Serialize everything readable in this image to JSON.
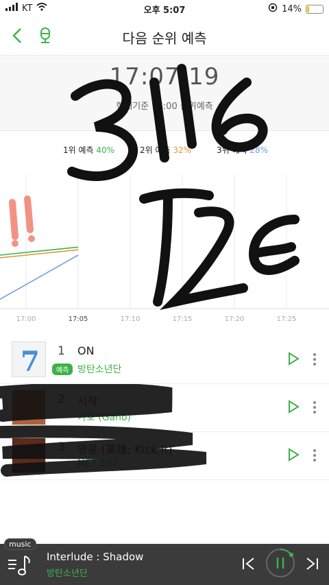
{
  "status": {
    "carrier": "KT",
    "time": "오후 5:07",
    "battery": "14%",
    "battery_level": 0.14
  },
  "header": {
    "title": "다음 순위 예측"
  },
  "timer": {
    "time": "17:07:19",
    "subtitle": "현재기준 18:00 순위예측"
  },
  "predictions": [
    {
      "label": "1위 예측",
      "value": "40%",
      "color": "#3cb34a"
    },
    {
      "label": "2위 예측",
      "value": "32%",
      "color": "#e0983a"
    },
    {
      "label": "3위 예측",
      "value": "28%",
      "color": "#6fa0e0"
    }
  ],
  "chart_data": {
    "type": "line",
    "x": [
      "17:00",
      "17:05",
      "17:10",
      "17:15",
      "17:20",
      "17:25"
    ],
    "xlabel": "",
    "ylabel": "",
    "series": [
      {
        "color": "#3cb34a",
        "values": [
          42,
          46
        ]
      },
      {
        "color": "#e0983a",
        "values": [
          40,
          44
        ]
      },
      {
        "color": "#6fa0e0",
        "values": [
          18,
          40
        ]
      }
    ],
    "ylim": [
      0,
      100
    ],
    "grid": true
  },
  "chart_ticks": [
    "17:00",
    "17:05",
    "17:10",
    "17:15",
    "17:20",
    "17:25"
  ],
  "list": [
    {
      "rank": "1",
      "title": "ON",
      "badge": "예측",
      "artist": "방탄소년단"
    },
    {
      "rank": "2",
      "title": "시작",
      "badge": "",
      "artist": "가호 (Gaho)"
    },
    {
      "rank": "3",
      "title": "영웅 (英雄; Kick It)",
      "badge": "",
      "artist": "NCT 127"
    }
  ],
  "player": {
    "tag": "music",
    "title": "Interlude : Shadow",
    "artist": "방탄소년단"
  },
  "annotations": {
    "top": "3116",
    "middle": "IZE"
  }
}
